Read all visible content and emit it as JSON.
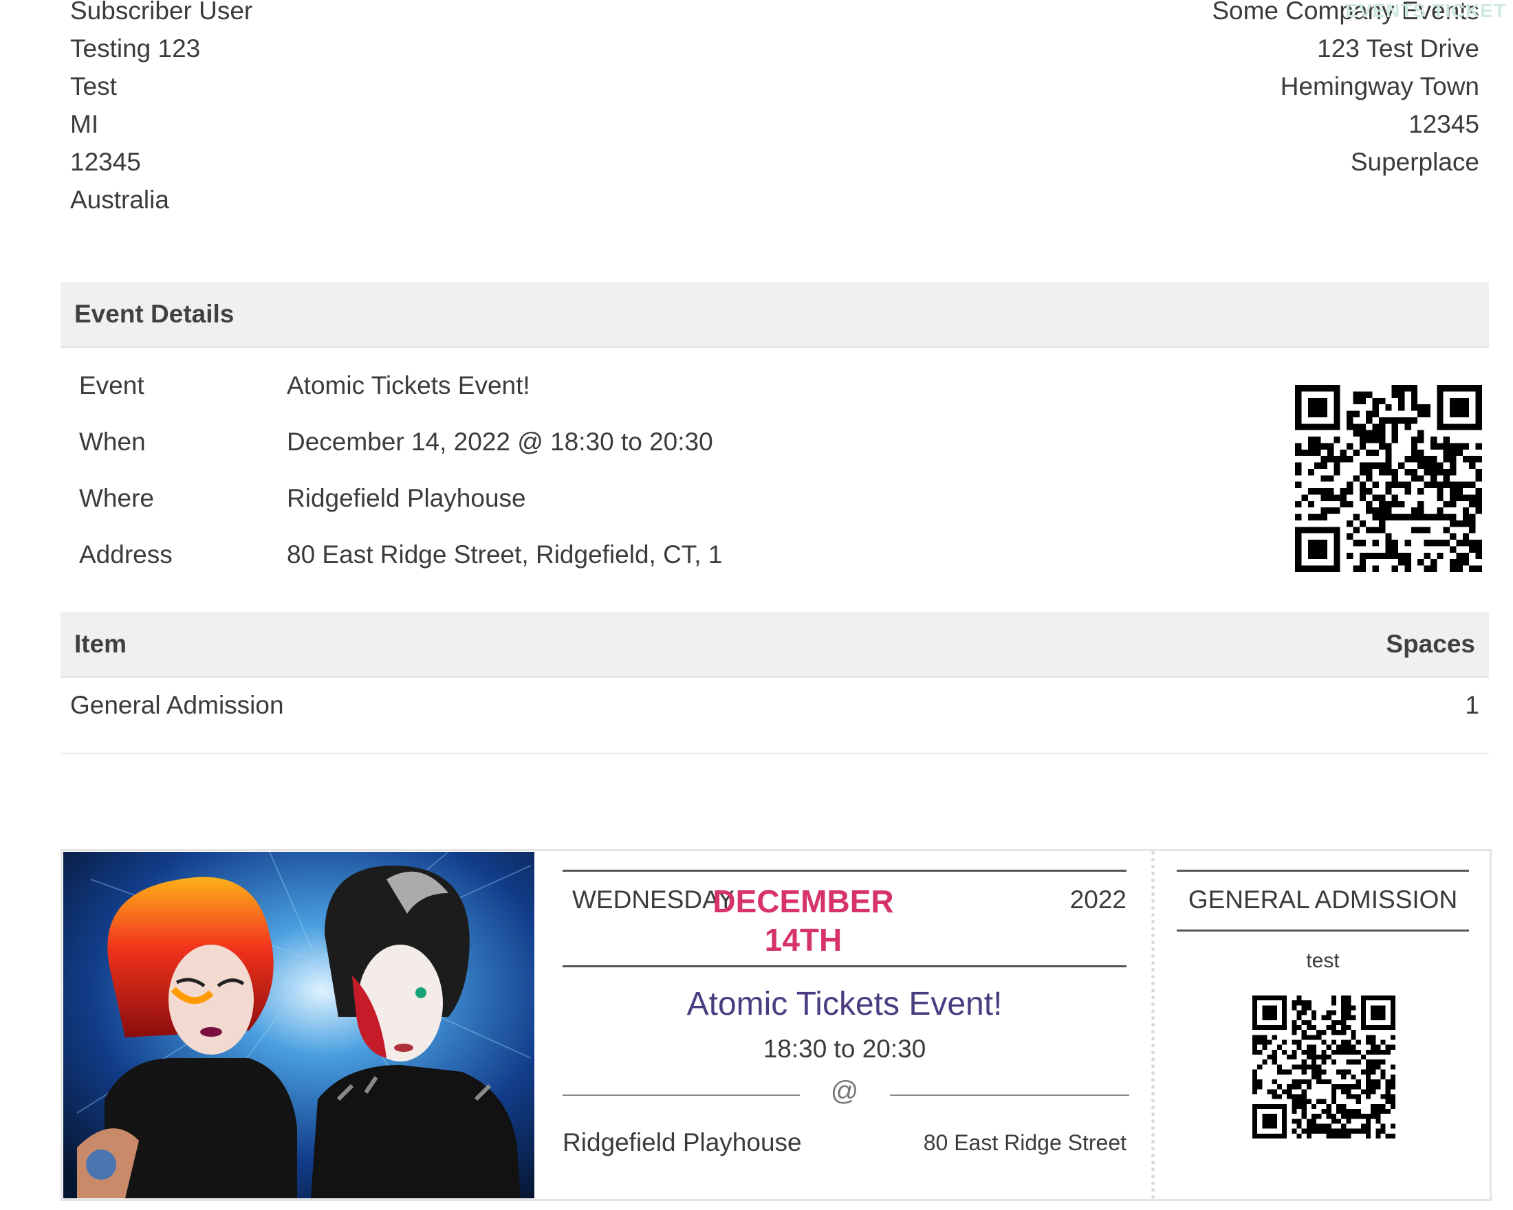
{
  "subscriber": {
    "lines": [
      "Subscriber User",
      "Testing 123",
      "Test",
      "MI",
      "12345",
      "Australia"
    ]
  },
  "company": {
    "lines": [
      "Some Company Events",
      "123 Test Drive",
      "Hemingway Town",
      "12345",
      "Superplace"
    ],
    "watermark": "EVENTS TICKET"
  },
  "event_details": {
    "heading": "Event Details",
    "rows": [
      {
        "label": "Event",
        "value": "Atomic Tickets Event!"
      },
      {
        "label": "When",
        "value": "December 14, 2022 @ 18:30 to 20:30"
      },
      {
        "label": "Where",
        "value": "Ridgefield Playhouse"
      },
      {
        "label": "Address",
        "value": "80 East Ridge Street, Ridgefield, CT, 1"
      }
    ],
    "qr_icon": "qr-code-icon"
  },
  "items": {
    "col_item": "Item",
    "col_spaces": "Spaces",
    "rows": [
      {
        "item": "General Admission",
        "spaces": "1"
      }
    ]
  },
  "ticket": {
    "image": "event-photo",
    "day": "WEDNESDAY",
    "month": "DECEMBER",
    "date": "14TH",
    "year": "2022",
    "event_name": "Atomic Tickets Event!",
    "time": "18:30 to 20:30",
    "at": "@",
    "venue": "Ridgefield Playhouse",
    "street": "80 East Ridge Street",
    "admission": "GENERAL ADMISSION",
    "note": "test",
    "accent_color": "#d6336c",
    "title_color": "#4b3b80"
  }
}
